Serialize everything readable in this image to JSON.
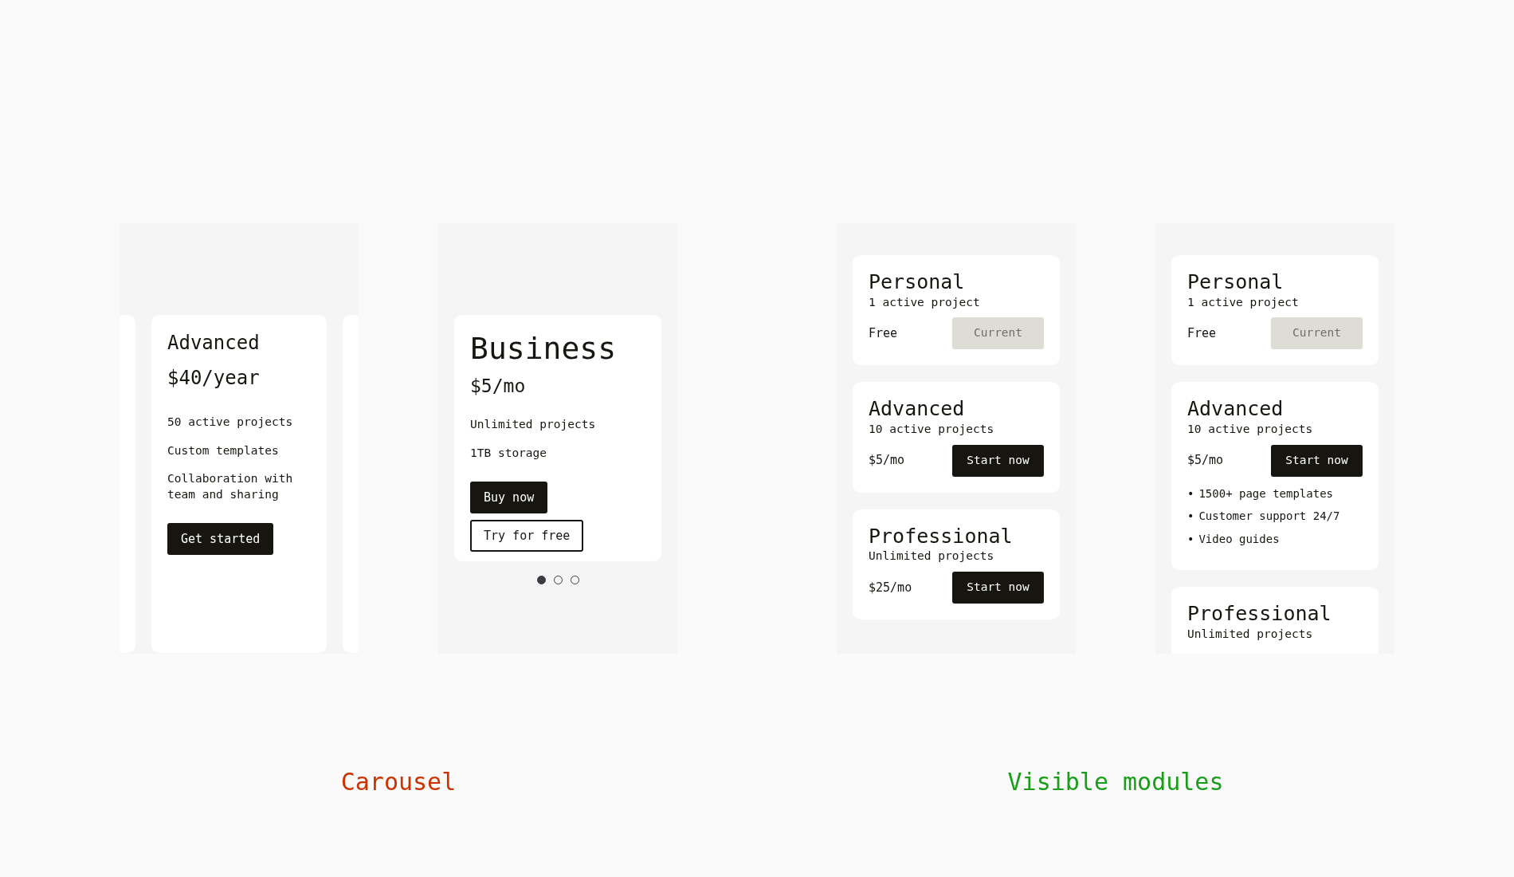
{
  "sections": [
    {
      "label": "Carousel",
      "color": "#cc3300",
      "panels": [
        {
          "kind": "peek",
          "cards": [
            {
              "kind": "compact",
              "title": "Advanced",
              "price": "$40/year",
              "features": [
                "50 active projects",
                "Custom templates",
                "Collaboration with team and sharing"
              ],
              "buttons": [
                {
                  "label": "Get started",
                  "kind": "solid"
                }
              ]
            }
          ]
        },
        {
          "kind": "single",
          "cards": [
            {
              "kind": "featured",
              "title": "Business",
              "price": "$5/mo",
              "features": [
                "Unlimited projects",
                "1TB storage"
              ],
              "buttons": [
                {
                  "label": "Buy now",
                  "kind": "solid"
                },
                {
                  "label": "Try for free",
                  "kind": "outline"
                }
              ]
            }
          ],
          "dots": [
            {
              "selected": true
            },
            {
              "selected": false
            },
            {
              "selected": false
            }
          ]
        }
      ]
    },
    {
      "label": "Visible modules",
      "color": "#1a9e1a",
      "panels": [
        {
          "kind": "stack",
          "plans": [
            {
              "title": "Personal",
              "subtitle": "1 active project",
              "price": "Free",
              "button": {
                "label": "Current",
                "disabled": true
              }
            },
            {
              "title": "Advanced",
              "subtitle": "10 active projects",
              "price": "$5/mo",
              "button": {
                "label": "Start now",
                "disabled": false
              }
            },
            {
              "title": "Professional",
              "subtitle": "Unlimited projects",
              "price": "$25/mo",
              "button": {
                "label": "Start now",
                "disabled": false
              }
            }
          ]
        },
        {
          "kind": "stack",
          "plans": [
            {
              "title": "Personal",
              "subtitle": "1 active project",
              "price": "Free",
              "button": {
                "label": "Current",
                "disabled": true
              }
            },
            {
              "title": "Advanced",
              "subtitle": "10 active projects",
              "price": "$5/mo",
              "button": {
                "label": "Start now",
                "disabled": false
              },
              "features": [
                {
                  "marker": "•",
                  "text": "1500+ page templates"
                },
                {
                  "marker": "•",
                  "text": "Customer support 24/7"
                },
                {
                  "marker": "•",
                  "text": "Video guides"
                }
              ]
            },
            {
              "title": "Professional",
              "subtitle": "Unlimited projects"
            }
          ]
        }
      ]
    }
  ]
}
